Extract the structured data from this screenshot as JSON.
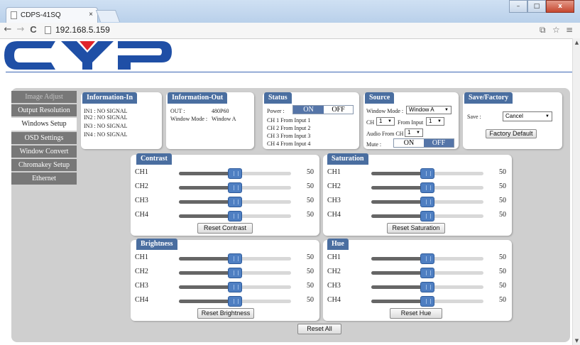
{
  "browser": {
    "tab_title": "CDPS-41SQ",
    "tab_close": "×",
    "url": "192.168.5.159",
    "back": "←",
    "forward": "→",
    "reload": "C",
    "win_min": "–",
    "win_max": "□",
    "win_close": "x"
  },
  "sidebar": {
    "items": [
      {
        "label": "Image Adjust",
        "state": "muted"
      },
      {
        "label": "Output Resolution",
        "state": "normal"
      },
      {
        "label": "Windows Setup",
        "state": "active"
      },
      {
        "label": "OSD Settings",
        "state": "normal"
      },
      {
        "label": "Window Convert",
        "state": "normal"
      },
      {
        "label": "Chromakey Setup",
        "state": "normal"
      },
      {
        "label": "Ethernet",
        "state": "normal"
      }
    ]
  },
  "info_in": {
    "title": "Information-In",
    "lines": [
      "IN1 : NO SIGNAL",
      "IN2 : NO SIGNAL",
      "IN3 : NO SIGNAL",
      "IN4 : NO SIGNAL"
    ]
  },
  "info_out": {
    "title": "Information-Out",
    "out_label": "OUT :",
    "out_value": "480P60",
    "mode_label": "Window Mode :",
    "mode_value": "Window A"
  },
  "status": {
    "title": "Status",
    "power_label": "Power :",
    "on": "ON",
    "off": "OFF",
    "lines": [
      "CH 1 From Input 1",
      "CH 2 From Input 2",
      "CH 3 From Input 3",
      "CH 4 From Input 4"
    ]
  },
  "source": {
    "title": "Source",
    "window_mode_label": "Window Mode :",
    "window_mode_value": "Window A",
    "ch_label": "CH",
    "ch_value": "1",
    "from_input_label": "From Input",
    "from_input_value": "1",
    "audio_label": "Audio From CH",
    "audio_value": "1",
    "mute_label": "Mute :",
    "on": "ON",
    "off": "OFF"
  },
  "save": {
    "title": "Save/Factory",
    "save_label": "Save :",
    "save_value": "Cancel",
    "factory_button": "Factory Default"
  },
  "contrast": {
    "title": "Contrast",
    "reset": "Reset Contrast",
    "channels": [
      {
        "label": "CH1",
        "value": 50
      },
      {
        "label": "CH2",
        "value": 50
      },
      {
        "label": "CH3",
        "value": 50
      },
      {
        "label": "CH4",
        "value": 50
      }
    ]
  },
  "saturation": {
    "title": "Saturation",
    "reset": "Reset Saturation",
    "channels": [
      {
        "label": "CH1",
        "value": 50
      },
      {
        "label": "CH2",
        "value": 50
      },
      {
        "label": "CH3",
        "value": 50
      },
      {
        "label": "CH4",
        "value": 50
      }
    ]
  },
  "brightness": {
    "title": "Brightness",
    "reset": "Reset Brightness",
    "channels": [
      {
        "label": "CH1",
        "value": 50
      },
      {
        "label": "CH2",
        "value": 50
      },
      {
        "label": "CH3",
        "value": 50
      },
      {
        "label": "CH4",
        "value": 50
      }
    ]
  },
  "hue": {
    "title": "Hue",
    "reset": "Reset Hue",
    "channels": [
      {
        "label": "CH1",
        "value": 50
      },
      {
        "label": "CH2",
        "value": 50
      },
      {
        "label": "CH3",
        "value": 50
      },
      {
        "label": "CH4",
        "value": 50
      }
    ]
  },
  "reset_all": "Reset All",
  "colors": {
    "header_blue": "#4a6ea0",
    "handle_blue": "#4f7fc2",
    "logo_blue": "#1f4fa6",
    "logo_red": "#e0242a"
  },
  "slider_max": 100
}
